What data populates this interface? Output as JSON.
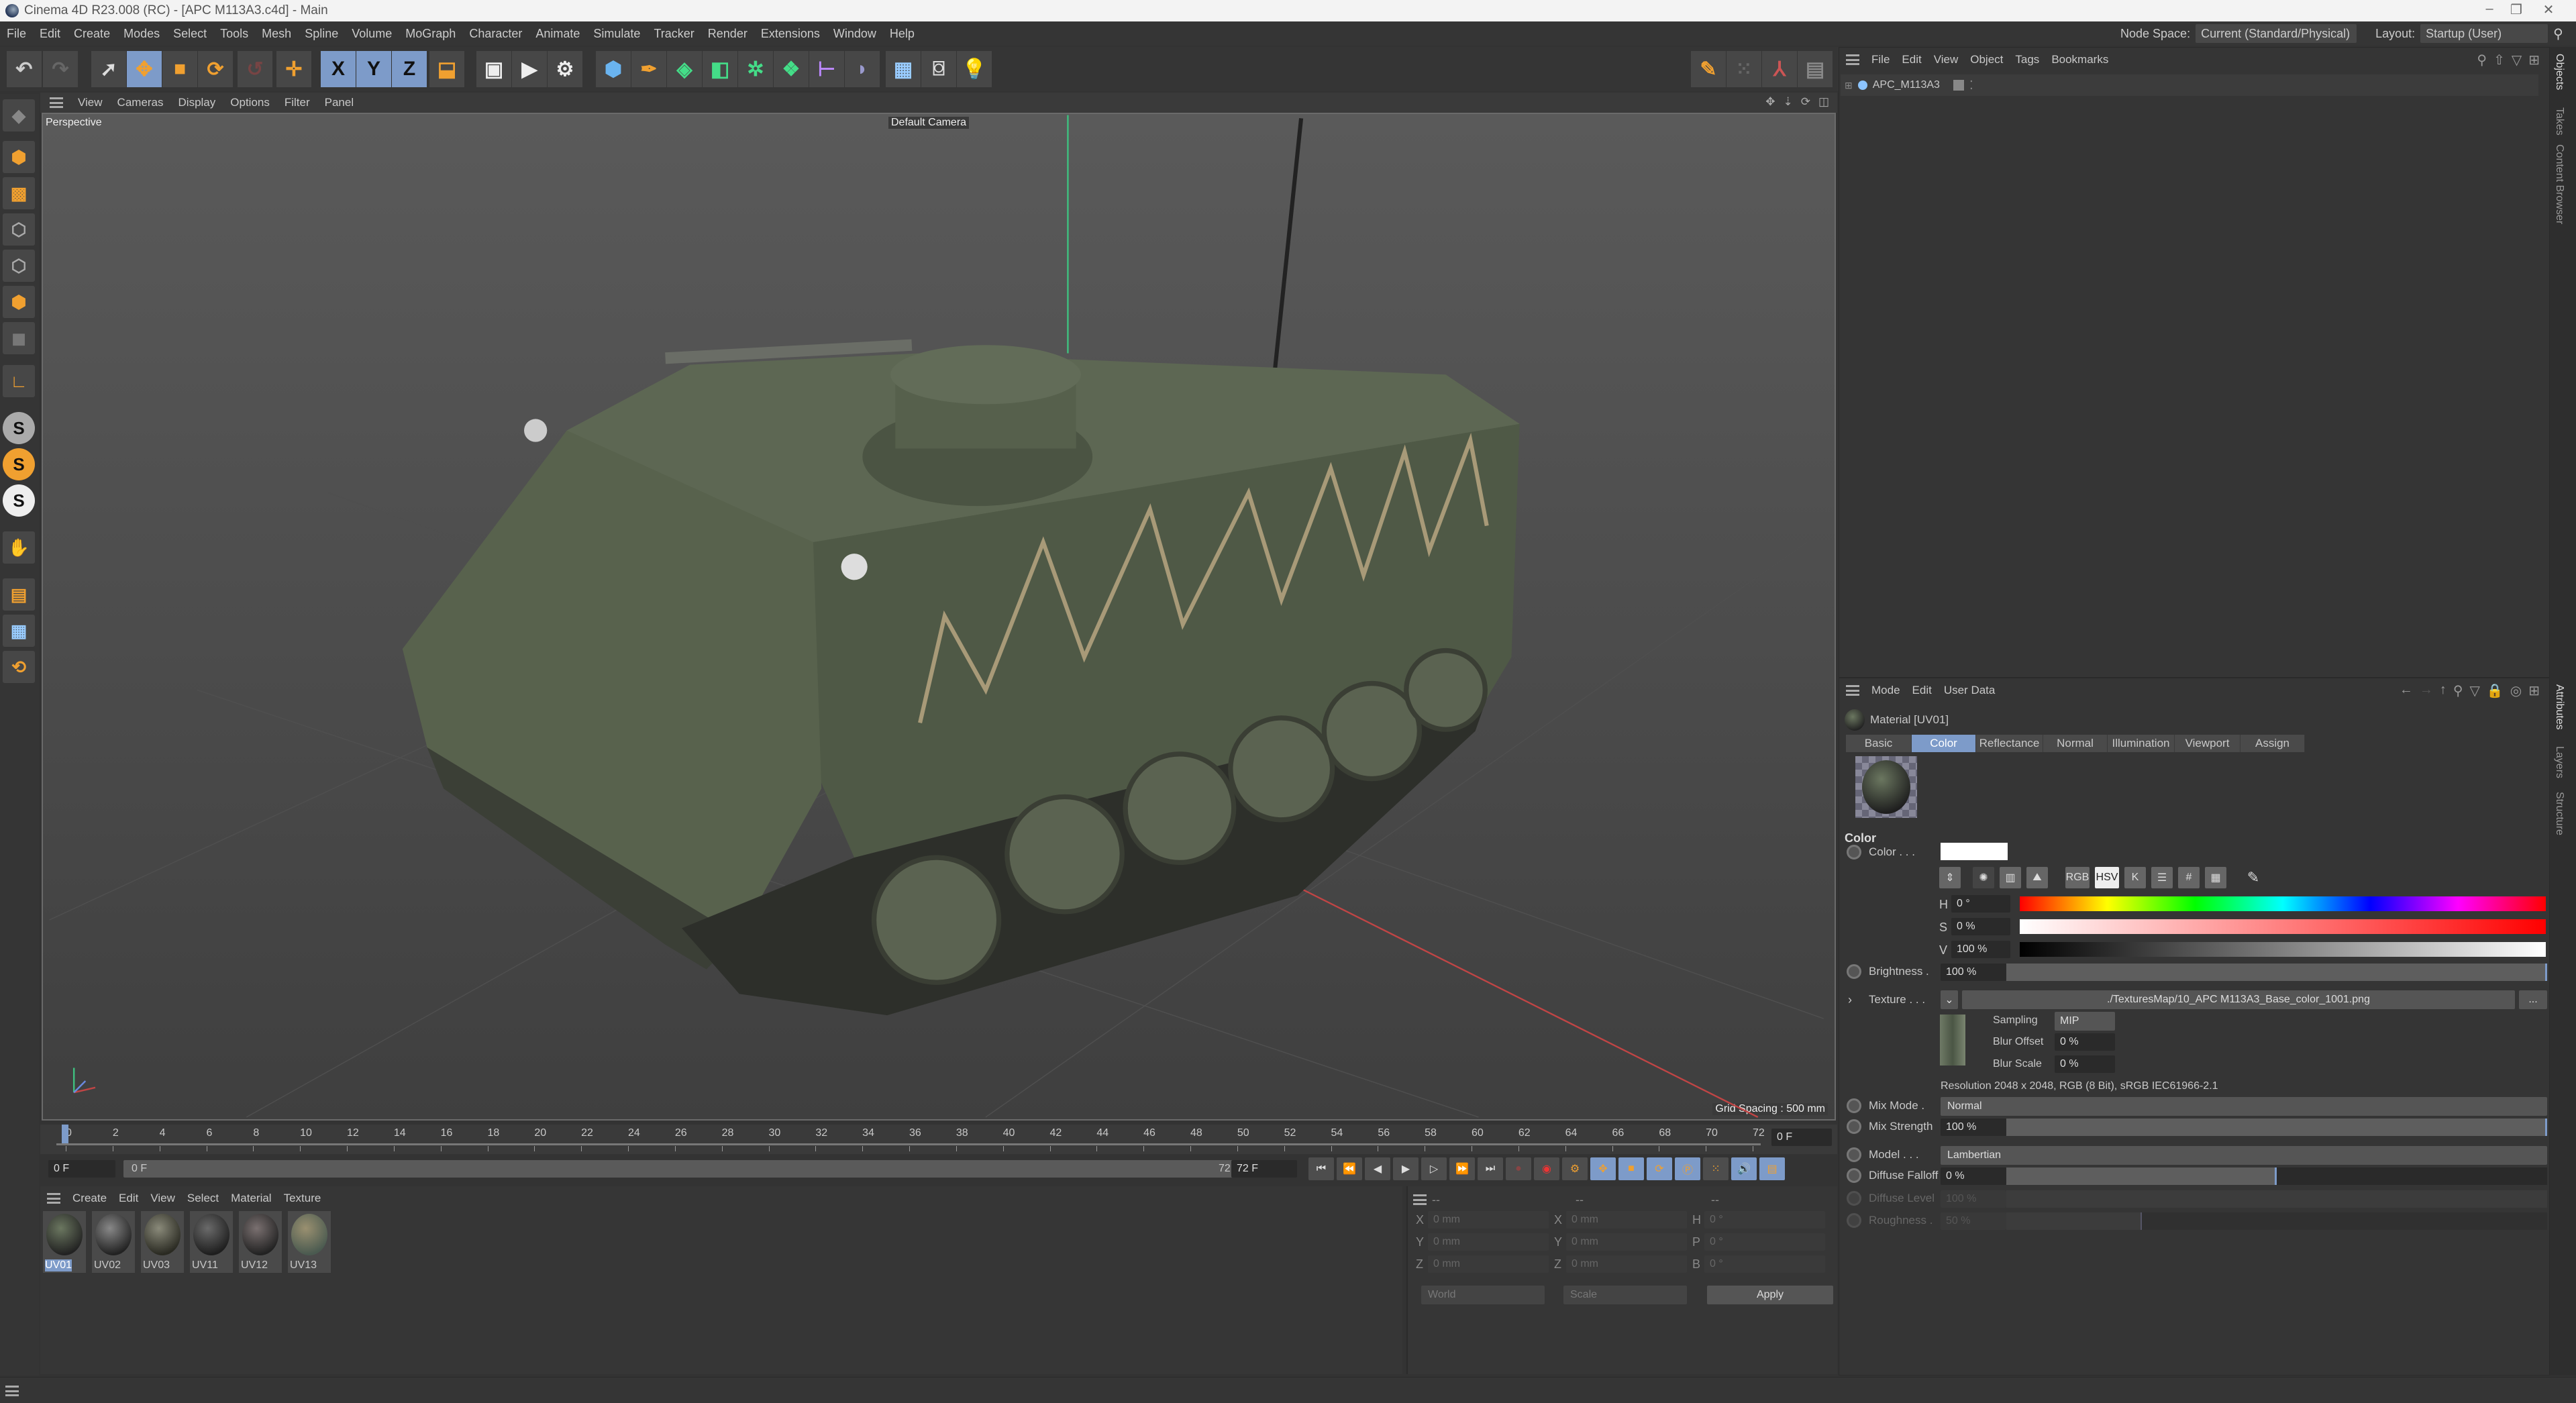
{
  "window": {
    "title": "Cinema 4D R23.008 (RC) - [APC M113A3.c4d] - Main",
    "minimize": "–",
    "restore": "❐",
    "close": "✕"
  },
  "menu": [
    "File",
    "Edit",
    "Create",
    "Modes",
    "Select",
    "Tools",
    "Mesh",
    "Spline",
    "Volume",
    "MoGraph",
    "Character",
    "Animate",
    "Simulate",
    "Tracker",
    "Render",
    "Extensions",
    "Window",
    "Help"
  ],
  "header": {
    "node_space_label": "Node Space:",
    "node_space_value": "Current (Standard/Physical)",
    "layout_label": "Layout:",
    "layout_value": "Startup (User)"
  },
  "toolbar": {
    "axis_x": "X",
    "axis_y": "Y",
    "axis_z": "Z"
  },
  "viewport": {
    "menu": [
      "View",
      "Cameras",
      "Display",
      "Options",
      "Filter",
      "Panel"
    ],
    "view_name": "Perspective",
    "camera": "Default Camera",
    "grid_spacing": "Grid Spacing : 500 mm"
  },
  "objects": {
    "menu": [
      "File",
      "Edit",
      "View",
      "Object",
      "Tags",
      "Bookmarks"
    ],
    "items": [
      {
        "name": "APC_M113A3"
      }
    ]
  },
  "side_tabs": {
    "top": [
      "Objects",
      "Takes",
      "Content Browser"
    ],
    "bottom": [
      "Attributes",
      "Layers",
      "Structure"
    ]
  },
  "timeline": {
    "start": 0,
    "end": 72,
    "step": 2,
    "current_frame": "0 F",
    "min_field": "0 F",
    "range_start": "0 F",
    "range_end": "72 F",
    "max_field": "72 F",
    "right_field": "0 F"
  },
  "materials": {
    "menu": [
      "Create",
      "Edit",
      "View",
      "Select",
      "Material",
      "Texture"
    ],
    "items": [
      {
        "name": "UV01",
        "selected": true
      },
      {
        "name": "UV02"
      },
      {
        "name": "UV03"
      },
      {
        "name": "UV11"
      },
      {
        "name": "UV12"
      },
      {
        "name": "UV13"
      }
    ]
  },
  "coordinates": {
    "headers": [
      "--",
      "--",
      "--"
    ],
    "pos": [
      {
        "axis": "X",
        "value": "0 mm"
      },
      {
        "axis": "Y",
        "value": "0 mm"
      },
      {
        "axis": "Z",
        "value": "0 mm"
      }
    ],
    "size": [
      {
        "axis": "X",
        "value": "0 mm"
      },
      {
        "axis": "Y",
        "value": "0 mm"
      },
      {
        "axis": "Z",
        "value": "0 mm"
      }
    ],
    "rot": [
      {
        "axis": "H",
        "value": "0 °"
      },
      {
        "axis": "P",
        "value": "0 °"
      },
      {
        "axis": "B",
        "value": "0 °"
      }
    ],
    "space": "World",
    "mode": "Scale",
    "apply": "Apply"
  },
  "attributes": {
    "menu": [
      "Mode",
      "Edit",
      "User Data"
    ],
    "title": "Material [UV01]",
    "tabs": [
      "Basic",
      "Color",
      "Reflectance",
      "Normal",
      "Illumination",
      "Viewport",
      "Assign"
    ],
    "active_tab": "Color",
    "section": "Color",
    "color_label": "Color . . .",
    "color_value": "#ffffff",
    "mode_buttons": [
      "RGB",
      "HSV",
      "K",
      "#"
    ],
    "h_label": "H",
    "h": "0 °",
    "s_label": "S",
    "s": "0 %",
    "v_label": "V",
    "v": "100 %",
    "brightness_label": "Brightness .",
    "brightness": "100 %",
    "brightness_fraction": 1.0,
    "texture_label": "Texture . . .",
    "texture_path": "./TexturesMap/10_APC M113A3_Base_color_1001.png",
    "texture_more": "...",
    "sampling_label": "Sampling",
    "sampling": "MIP",
    "blur_offset_label": "Blur Offset",
    "blur_offset": "0 %",
    "blur_scale_label": "Blur Scale",
    "blur_scale": "0 %",
    "resolution": "Resolution 2048 x 2048, RGB (8 Bit), sRGB IEC61966-2.1",
    "mix_mode_label": "Mix Mode .",
    "mix_mode": "Normal",
    "mix_strength_label": "Mix Strength",
    "mix_strength": "100 %",
    "model_label": "Model . . .",
    "model": "Lambertian",
    "diffuse_falloff_label": "Diffuse Falloff",
    "diffuse_falloff": "0 %",
    "diffuse_level_label": "Diffuse Level",
    "diffuse_level": "100 %",
    "roughness_label": "Roughness .",
    "roughness": "50 %"
  },
  "colors": {
    "accent": "#7d9bc9",
    "orange": "#f0a030",
    "bg": "#333333",
    "olive": "#56604c"
  }
}
